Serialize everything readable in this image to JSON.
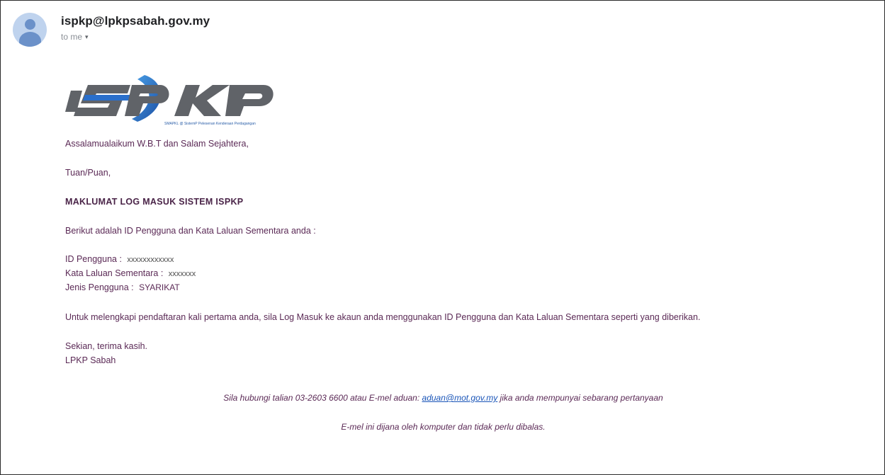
{
  "header": {
    "sender": "ispkp@lpkpsabah.gov.my",
    "recipient_label": "to me",
    "caret_icon": "caret-down-icon"
  },
  "logo": {
    "main_text": "iSPKP",
    "tagline": "SMAPKL @ SistemP Pelesenan Kenderaan Perdagangan"
  },
  "message": {
    "greeting": "Assalamualaikum W.B.T dan Salam Sejahtera,",
    "salutation": "Tuan/Puan,",
    "heading": "MAKLUMAT LOG MASUK SISTEM ISPKP",
    "intro": "Berikut adalah ID Pengguna dan Kata Laluan Sementara anda :",
    "user_id_label": "ID Pengguna :",
    "user_id_value": "xxxxxxxxxxxx",
    "temp_password_label": "Kata Laluan Sementara :",
    "temp_password_value": "xxxxxxx",
    "user_type_label": "Jenis Pengguna :",
    "user_type_value": "SYARIKAT",
    "instruction": "Untuk melengkapi pendaftaran kali pertama anda, sila Log Masuk ke akaun anda menggunakan ID Pengguna dan Kata Laluan Sementara seperti yang diberikan.",
    "closing": "Sekian, terima kasih.",
    "signature": "LPKP Sabah"
  },
  "footer": {
    "contact_prefix": "Sila hubungi talian 03-2603 6600 atau E-mel aduan: ",
    "contact_email": "aduan@mot.gov.my",
    "contact_suffix": " jika anda mempunyai sebarang pertanyaan",
    "auto_notice": "E-mel ini dijana oleh komputer dan tidak perlu dibalas."
  },
  "colors": {
    "body_text": "#5b2a56",
    "logo_grey": "#5f6165",
    "logo_blue": "#1f5fb0",
    "link": "#1a55b8"
  }
}
